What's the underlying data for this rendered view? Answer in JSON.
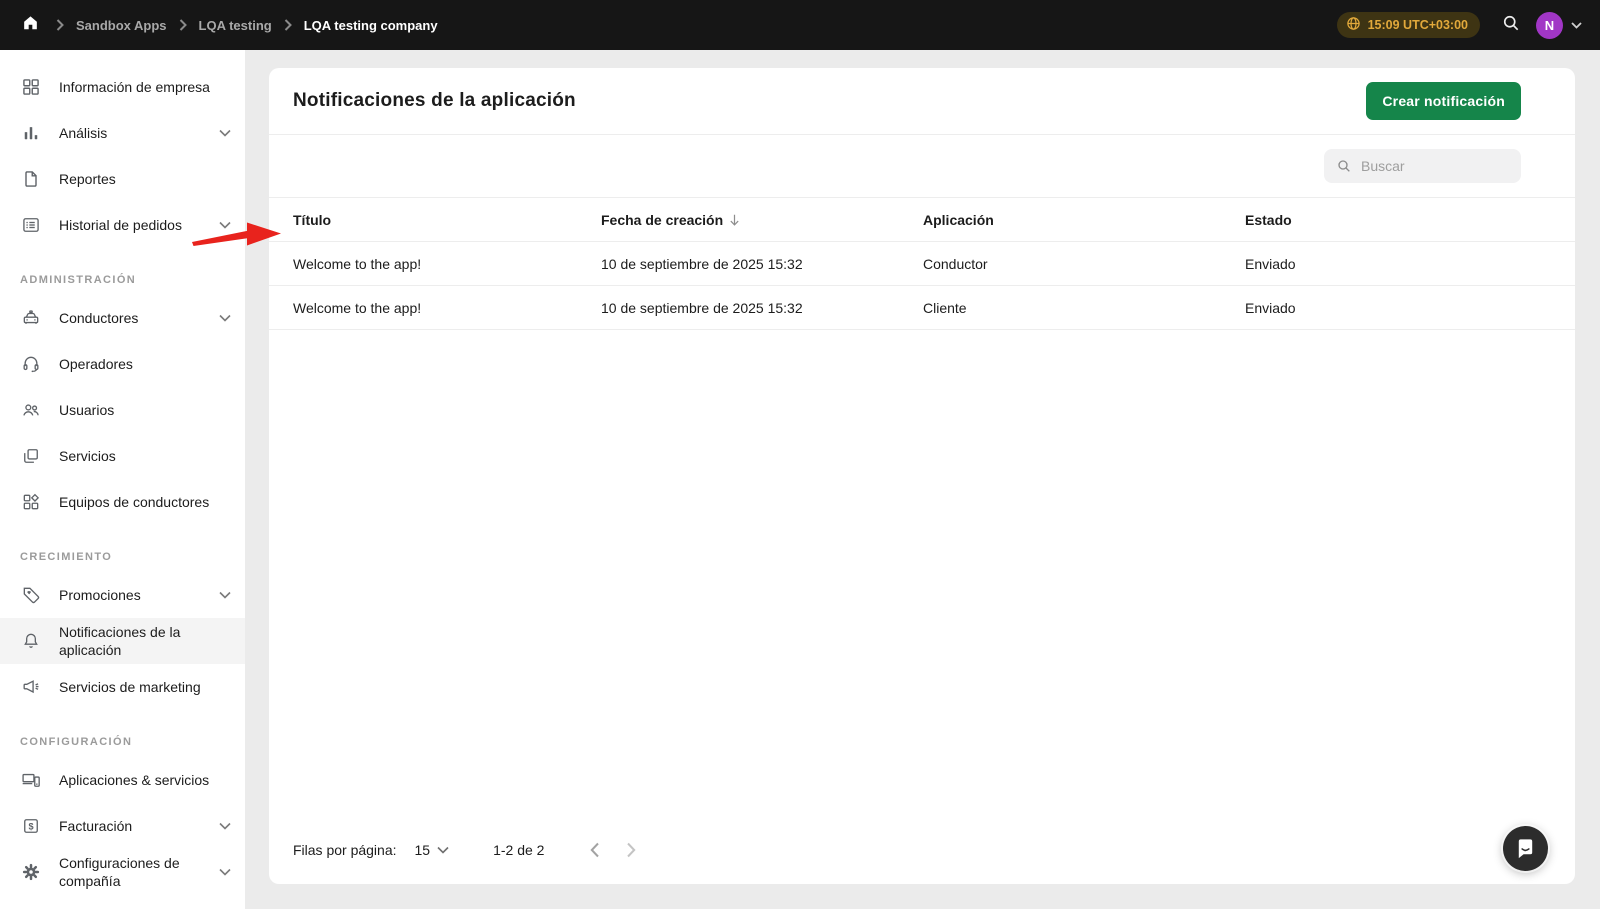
{
  "topbar": {
    "breadcrumbs": [
      "Sandbox Apps",
      "LQA testing",
      "LQA testing company"
    ],
    "time": "15:09 UTC+03:00",
    "avatar_initial": "N"
  },
  "sidebar": {
    "sections": [
      {
        "title": "",
        "items": [
          {
            "icon": "dashboard-icon",
            "label": "Información de empresa"
          },
          {
            "icon": "analytics-icon",
            "label": "Análisis"
          },
          {
            "icon": "reports-icon",
            "label": "Reportes"
          },
          {
            "icon": "order-history-icon",
            "label": "Historial de pedidos"
          }
        ]
      },
      {
        "title": "ADMINISTRACIÓN",
        "items": [
          {
            "icon": "taxi-icon",
            "label": "Conductores"
          },
          {
            "icon": "headset-icon",
            "label": "Operadores"
          },
          {
            "icon": "users-icon",
            "label": "Usuarios"
          },
          {
            "icon": "services-icon",
            "label": "Servicios"
          },
          {
            "icon": "driver-teams-icon",
            "label": "Equipos de conductores"
          }
        ]
      },
      {
        "title": "CRECIMIENTO",
        "items": [
          {
            "icon": "promotions-icon",
            "label": "Promociones"
          },
          {
            "icon": "bell-icon",
            "label": "Notificaciones de la aplicación"
          },
          {
            "icon": "megaphone-icon",
            "label": "Servicios de marketing"
          }
        ]
      },
      {
        "title": "CONFIGURACIÓN",
        "items": [
          {
            "icon": "devices-icon",
            "label": "Aplicaciones & servicios"
          },
          {
            "icon": "billing-icon",
            "label": "Facturación"
          },
          {
            "icon": "gear-icon",
            "label": "Configuraciones de compañía"
          }
        ]
      }
    ]
  },
  "main": {
    "title": "Notificaciones de la aplicación",
    "create_button": "Crear notificación",
    "search_placeholder": "Buscar",
    "table": {
      "columns": [
        "Título",
        "Fecha de creación",
        "Aplicación",
        "Estado"
      ],
      "rows": [
        [
          "Welcome to the app!",
          "10 de septiembre de 2025 15:32",
          "Conductor",
          "Enviado"
        ],
        [
          "Welcome to the app!",
          "10 de septiembre de 2025 15:32",
          "Cliente",
          "Enviado"
        ]
      ]
    },
    "pagination": {
      "label": "Filas por página:",
      "value": "15",
      "range": "1-2 de 2"
    }
  },
  "colors": {
    "accent_green": "#15854a",
    "gold": "#e2a93b",
    "avatar_purple": "#a136c6",
    "arrow_red": "#e8231d",
    "topbar_bg": "#161616"
  }
}
